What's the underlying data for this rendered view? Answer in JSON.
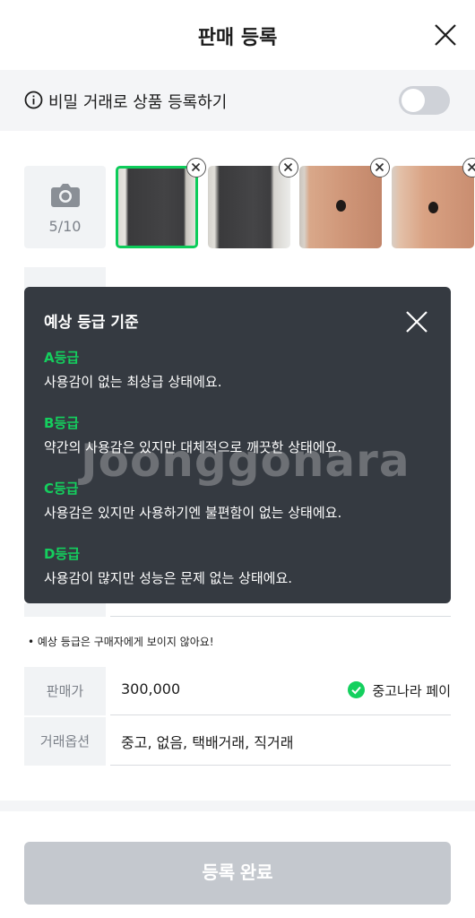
{
  "header": {
    "title": "판매 등록"
  },
  "secret_trade": {
    "label": "비밀 거래로 상품 등록하기",
    "enabled": false
  },
  "photos": {
    "count": "5/10",
    "thumbnails": [
      "tablet-dark-1",
      "tablet-dark-2",
      "ipad-gold-1",
      "ipad-gold-2"
    ],
    "selected_index": 0
  },
  "popup": {
    "title": "예상 등급 기준",
    "watermark": "Joonggonara",
    "grades": [
      {
        "grade": "A등급",
        "desc": "사용감이 없는 최상급 상태에요."
      },
      {
        "grade": "B등급",
        "desc": "약간의 사용감은 있지만 대체적으로 깨끗한 상태에요."
      },
      {
        "grade": "C등급",
        "desc": "사용감은 있지만 사용하기엔 불편함이 없는 상태에요."
      },
      {
        "grade": "D등급",
        "desc": "사용감이 많지만 성능은 문제 없는 상태에요."
      }
    ]
  },
  "note": "• 예상 등급은 구매자에게 보이지 않아요!",
  "price": {
    "label": "판매가",
    "value": "300,000",
    "pay_label": "중고나라 페이"
  },
  "trade_options": {
    "label": "거래옵션",
    "value": "중고, 없음, 택배거래, 직거래"
  },
  "submit": {
    "label": "등록 완료"
  },
  "colors": {
    "accent_green": "#14d05e",
    "popup_bg": "#353a41",
    "submit_disabled": "#c4c8ce"
  }
}
